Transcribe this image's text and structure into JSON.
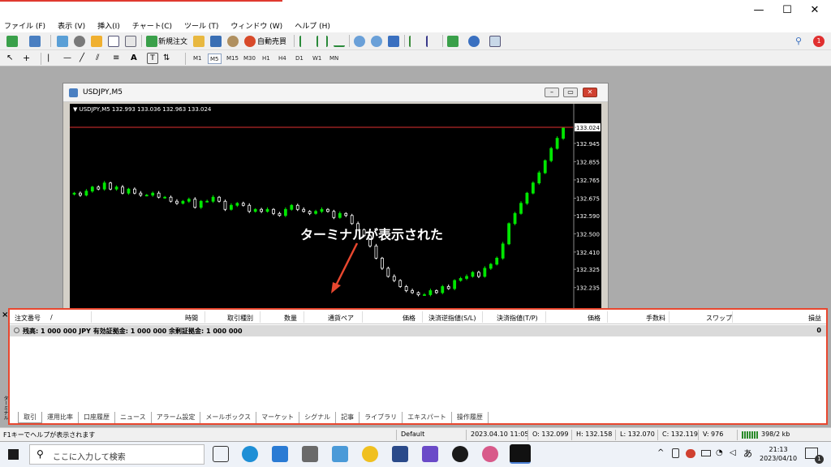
{
  "menu": [
    "ファイル (F)",
    "表示 (V)",
    "挿入(I)",
    "チャート(C)",
    "ツール (T)",
    "ウィンドウ (W)",
    "ヘルプ (H)"
  ],
  "toolbar": {
    "new_order_label": "新規注文",
    "auto_trade_label": "自動売買"
  },
  "timeframes": [
    "M1",
    "M5",
    "M15",
    "M30",
    "H1",
    "H4",
    "D1",
    "W1",
    "MN"
  ],
  "active_timeframe": "M5",
  "chart_window": {
    "title": "USDJPY,M5",
    "info": "▼ USDJPY,M5  132.993 133.036 132.963 133.024"
  },
  "annotation": "ターミナルが表示された",
  "chart_data": {
    "type": "candlestick",
    "symbol": "USDJPY,M5",
    "current_price": "133.024",
    "y_ticks": [
      "133.024",
      "132.945",
      "132.855",
      "132.765",
      "132.675",
      "132.590",
      "132.500",
      "132.410",
      "132.325",
      "132.235"
    ],
    "ylim": [
      132.15,
      133.1
    ],
    "closes": [
      132.7,
      132.69,
      132.71,
      132.73,
      132.72,
      132.75,
      132.72,
      132.73,
      132.7,
      132.72,
      132.7,
      132.69,
      132.69,
      132.7,
      132.68,
      132.68,
      132.66,
      132.65,
      132.66,
      132.67,
      132.63,
      132.66,
      132.66,
      132.68,
      132.66,
      132.62,
      132.64,
      132.65,
      132.64,
      132.61,
      132.62,
      132.61,
      132.62,
      132.6,
      132.59,
      132.62,
      132.64,
      132.62,
      132.61,
      132.6,
      132.61,
      132.62,
      132.61,
      132.58,
      132.6,
      132.59,
      132.55,
      132.52,
      132.49,
      132.44,
      132.38,
      132.33,
      132.29,
      132.27,
      132.24,
      132.22,
      132.21,
      132.2,
      132.2,
      132.22,
      132.21,
      132.24,
      132.23,
      132.27,
      132.28,
      132.29,
      132.31,
      132.29,
      132.33,
      132.35,
      132.38,
      132.45,
      132.55,
      132.6,
      132.65,
      132.7,
      132.75,
      132.8,
      132.86,
      132.92,
      132.97,
      133.02
    ]
  },
  "terminal": {
    "columns": [
      "注文番号",
      "/",
      "時間",
      "取引種別",
      "数量",
      "通貨ペア",
      "価格",
      "決済逆指値(S/L)",
      "決済指値(T/P)",
      "価格",
      "手数料",
      "スワップ",
      "損益"
    ],
    "balance_text": "残高: 1 000 000 JPY  有効証拠金: 1 000 000  余剰証拠金: 1 000 000",
    "balance_value": "0",
    "tabs": [
      "取引",
      "運用比率",
      "口座履歴",
      "ニュース",
      "アラーム設定",
      "メールボックス",
      "マーケット",
      "シグナル",
      "記事",
      "ライブラリ",
      "エキスパート",
      "操作履歴"
    ],
    "vertical_label": "ターミナル",
    "close_label": "×"
  },
  "status": {
    "help": "F1キーでヘルプが表示されます",
    "profile": "Default",
    "datetime": "2023.04.10 11:05",
    "open": "O: 132.099",
    "high": "H: 132.158",
    "low": "L: 132.070",
    "close": "C: 132.119",
    "volume": "V: 976",
    "traffic": "398/2 kb"
  },
  "taskbar": {
    "search_placeholder": "ここに入力して検索",
    "time": "21:13",
    "date": "2023/04/10",
    "ime": "あ",
    "notif_count": "1"
  },
  "window_controls": {
    "minimize": "—",
    "maximize": "☐",
    "close": "✕"
  },
  "colors": {
    "bull": "#00e600",
    "bear": "#ffffff",
    "accent": "#e8472f"
  }
}
